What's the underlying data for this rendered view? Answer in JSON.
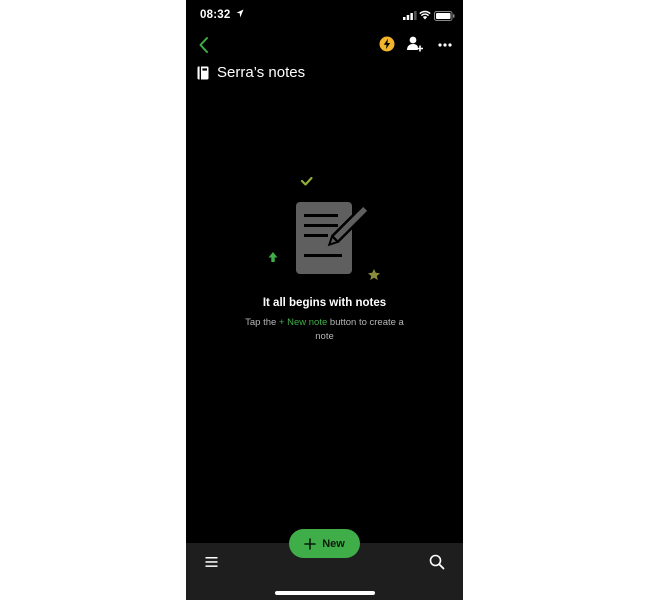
{
  "status_bar": {
    "time": "08:32",
    "icons": [
      "location-icon",
      "signal-icon",
      "wifi-icon",
      "battery-icon"
    ]
  },
  "header": {
    "back_icon": "chevron-left-icon",
    "actions": [
      "lightning-icon",
      "add-user-icon",
      "more-icon"
    ],
    "title": "Serra’s notes",
    "title_icon": "notebook-icon"
  },
  "empty_state": {
    "heading": "It all begins with notes",
    "text_before": "Tap the ",
    "link_text": "+ New note",
    "text_after": " button to create a note"
  },
  "bottom_bar": {
    "menu_icon": "hamburger-menu-icon",
    "search_icon": "search-icon",
    "new_button_label": "New"
  },
  "colors": {
    "background": "#000000",
    "accent_green": "#3fae49",
    "lightning_yellow": "#f2b42a",
    "bottom_bar": "#1e1e1e",
    "illustration_gray": "#5f5f5f"
  }
}
